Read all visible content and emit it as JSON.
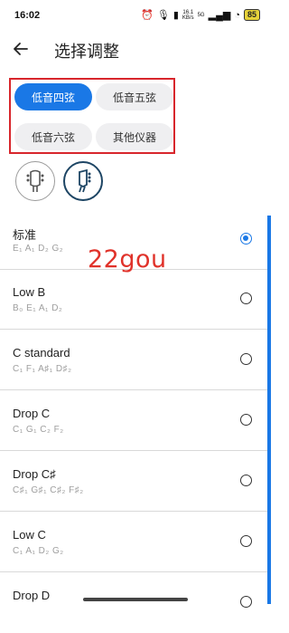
{
  "status_bar": {
    "time": "16:02",
    "net_speed_value": "16.1",
    "net_speed_unit": "KB/s",
    "network": "5G",
    "battery": "85"
  },
  "header": {
    "title": "选择调整"
  },
  "instrument_tabs": [
    {
      "label": "低音四弦",
      "selected": true
    },
    {
      "label": "低音五弦",
      "selected": false
    },
    {
      "label": "低音六弦",
      "selected": false
    },
    {
      "label": "其他仪器",
      "selected": false
    }
  ],
  "headstock_options": [
    {
      "icon": "headstock-3x3-icon",
      "selected": false
    },
    {
      "icon": "headstock-inline-icon",
      "selected": true
    }
  ],
  "watermark": "22gou",
  "tunings": [
    {
      "name": "标准",
      "notes": "E₁ A₁ D₂ G₂",
      "selected": true
    },
    {
      "name": "Low B",
      "notes": "B₀ E₁ A₁ D₂",
      "selected": false
    },
    {
      "name": "C standard",
      "notes": "C₁ F₁ A♯₁ D♯₂",
      "selected": false
    },
    {
      "name": "Drop C",
      "notes": "C₁ G₁ C₂ F₂",
      "selected": false
    },
    {
      "name": "Drop C♯",
      "notes": "C♯₁ G♯₁ C♯₂ F♯₂",
      "selected": false
    },
    {
      "name": "Low C",
      "notes": "C₁ A₁ D₂ G₂",
      "selected": false
    },
    {
      "name": "Drop D",
      "notes": "",
      "selected": false
    }
  ],
  "colors": {
    "accent": "#1a78e6",
    "highlight_box": "#d8262c",
    "watermark": "#e0322a"
  }
}
